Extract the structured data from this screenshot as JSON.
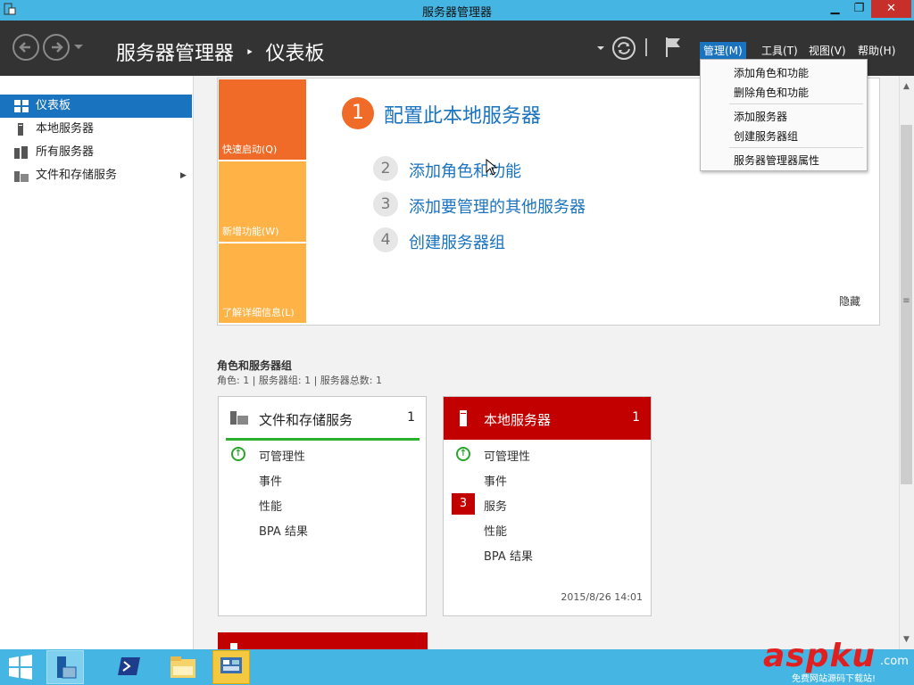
{
  "window": {
    "title": "服务器管理器",
    "minimize": "▁",
    "maximize": "❐",
    "close": "✕"
  },
  "header": {
    "breadcrumb_root": "服务器管理器",
    "breadcrumb_sep": "‣",
    "breadcrumb_current": "仪表板",
    "menus": {
      "manage": "管理(M)",
      "tools": "工具(T)",
      "view": "视图(V)",
      "help": "帮助(H)"
    }
  },
  "sidebar": {
    "items": [
      {
        "label": "仪表板",
        "icon": "dashboard-icon",
        "selected": true
      },
      {
        "label": "本地服务器",
        "icon": "server-icon"
      },
      {
        "label": "所有服务器",
        "icon": "servers-icon"
      },
      {
        "label": "文件和存储服务",
        "icon": "storage-icon",
        "expand": "▶"
      }
    ]
  },
  "welcome": {
    "tiles": {
      "quick": "快速启动(Q)",
      "new": "新增功能(W)",
      "learn": "了解详细信息(L)"
    },
    "main_step": {
      "num": "1",
      "label": "配置此本地服务器"
    },
    "steps": [
      {
        "num": "2",
        "label": "添加角色和功能"
      },
      {
        "num": "3",
        "label": "添加要管理的其他服务器"
      },
      {
        "num": "4",
        "label": "创建服务器组"
      }
    ],
    "hide": "隐藏"
  },
  "roles": {
    "title": "角色和服务器组",
    "summary": "角色: 1 | 服务器组: 1 | 服务器总数: 1",
    "cards": [
      {
        "title": "文件和存储服务",
        "count": "1",
        "rows": [
          "可管理性",
          "事件",
          "性能",
          "BPA 结果"
        ],
        "timestamp": ""
      },
      {
        "title": "本地服务器",
        "count": "1",
        "rows": [
          "可管理性",
          "事件",
          "服务",
          "性能",
          "BPA 结果"
        ],
        "badge": "3",
        "timestamp": "2015/8/26 14:01"
      }
    ]
  },
  "dropdown": {
    "items": [
      "添加角色和功能",
      "删除角色和功能",
      "添加服务器",
      "创建服务器组",
      "服务器管理器属性"
    ]
  },
  "taskbar": {
    "watermark": "aspku",
    "watermark_tld": ".com",
    "watermark_sub": "免费网站源码下载站!"
  },
  "scrollbar": {
    "grip": "≡"
  },
  "colors": {
    "accent": "#1a73bf",
    "orange": "#f06b28",
    "tile_yellow": "#ffb347",
    "alert_red": "#c30000",
    "ok_green": "#2aa52a"
  }
}
